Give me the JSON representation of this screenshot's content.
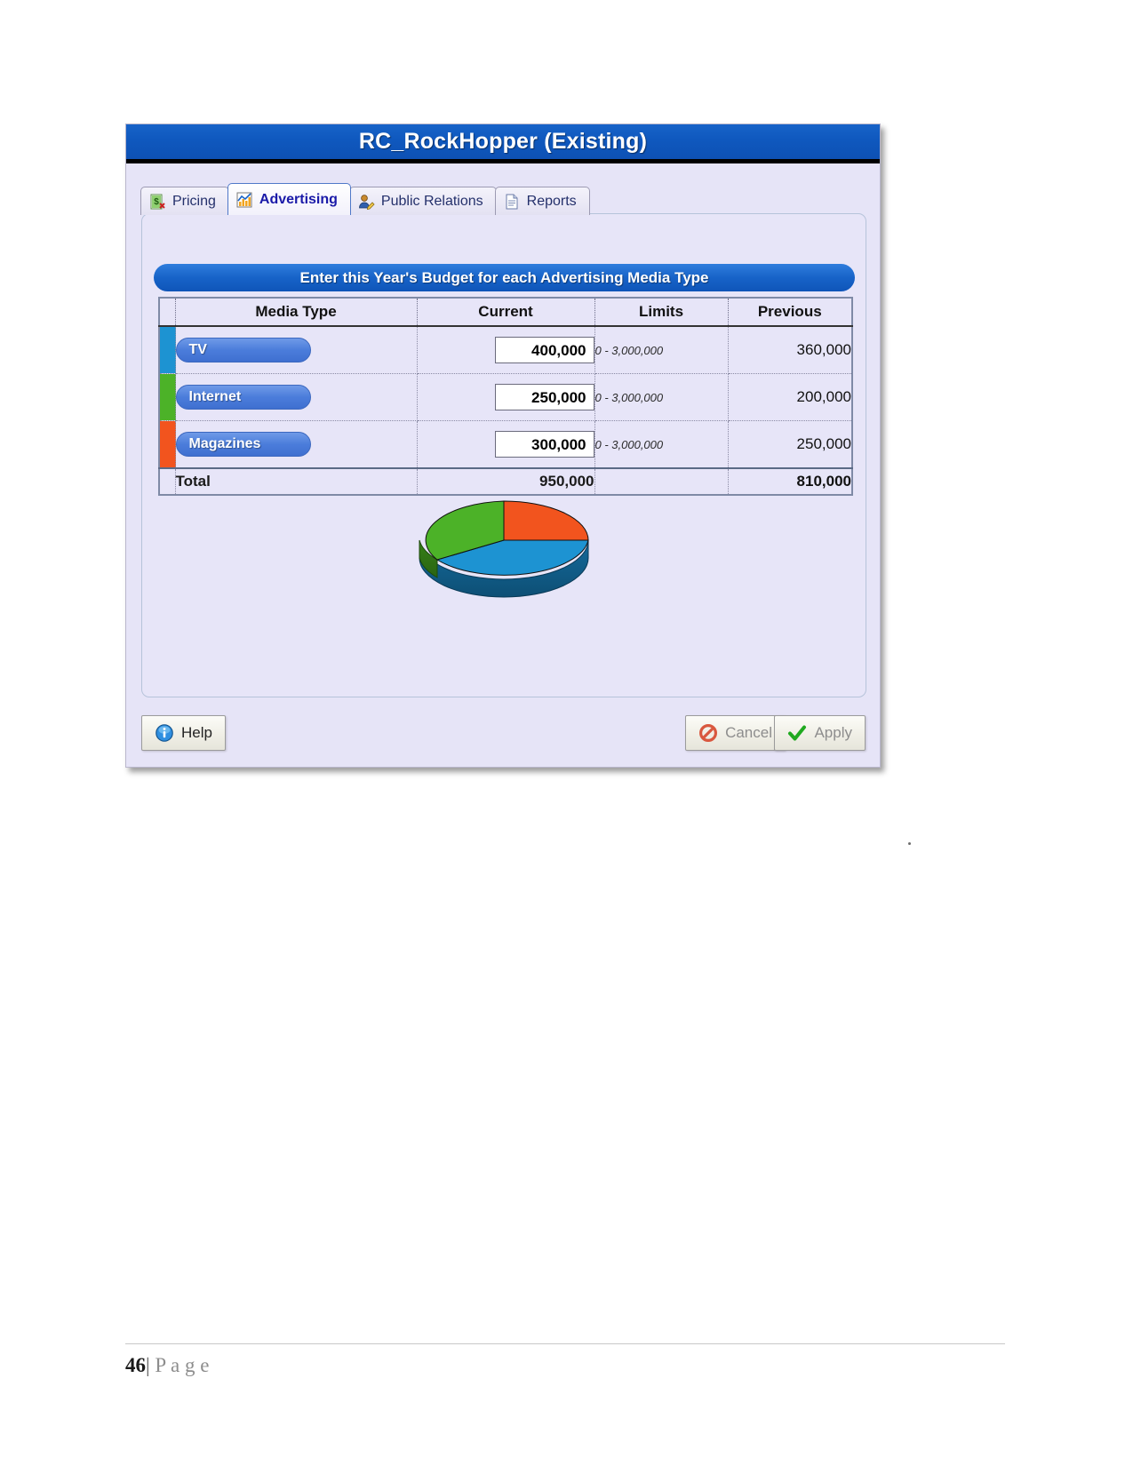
{
  "window": {
    "title": "RC_RockHopper (Existing)"
  },
  "tabs": [
    {
      "label": "Pricing",
      "icon": "pricing-document-icon",
      "selected": false
    },
    {
      "label": "Advertising",
      "icon": "chart-icon",
      "selected": true
    },
    {
      "label": "Public Relations",
      "icon": "person-edit-icon",
      "selected": false
    },
    {
      "label": "Reports",
      "icon": "report-document-icon",
      "selected": false
    }
  ],
  "panel": {
    "banner": "Enter this Year's Budget for each Advertising Media Type",
    "table": {
      "headers": [
        "Media Type",
        "Current",
        "Limits",
        "Previous"
      ],
      "rows": [
        {
          "media": "TV",
          "current": "400,000",
          "limits": "0 - 3,000,000",
          "previous": "360,000",
          "color": "#1d93d2"
        },
        {
          "media": "Internet",
          "current": "250,000",
          "limits": "0 - 3,000,000",
          "previous": "200,000",
          "color": "#4cb228"
        },
        {
          "media": "Magazines",
          "current": "300,000",
          "limits": "0 - 3,000,000",
          "previous": "250,000",
          "color": "#f2541e"
        }
      ],
      "total": {
        "label": "Total",
        "current": "950,000",
        "previous": "810,000"
      }
    }
  },
  "chart_data": {
    "type": "pie",
    "title": "",
    "categories": [
      "TV",
      "Magazines",
      "Internet"
    ],
    "values": [
      400000,
      300000,
      250000
    ],
    "percents": [
      42.1,
      31.6,
      26.3
    ],
    "colors": [
      "#1d93d2",
      "#f2541e",
      "#4cb228"
    ],
    "legend": "none",
    "three_d": true,
    "labels_shown": false
  },
  "footer_buttons": {
    "help": {
      "label": "Help",
      "icon": "info-icon",
      "disabled": false
    },
    "cancel": {
      "label": "Cancel",
      "icon": "no-entry-icon",
      "disabled": true
    },
    "apply": {
      "label": "Apply",
      "icon": "green-check-icon",
      "disabled": true
    }
  },
  "document_footer": {
    "page_number": "46",
    "separator": "|",
    "page_word": "P a g e"
  },
  "colors": {
    "title_bar": "#0f58be",
    "banner": "#1763c8",
    "panel_bg": "#e7e5f8",
    "pill": "#4b7ddb"
  }
}
